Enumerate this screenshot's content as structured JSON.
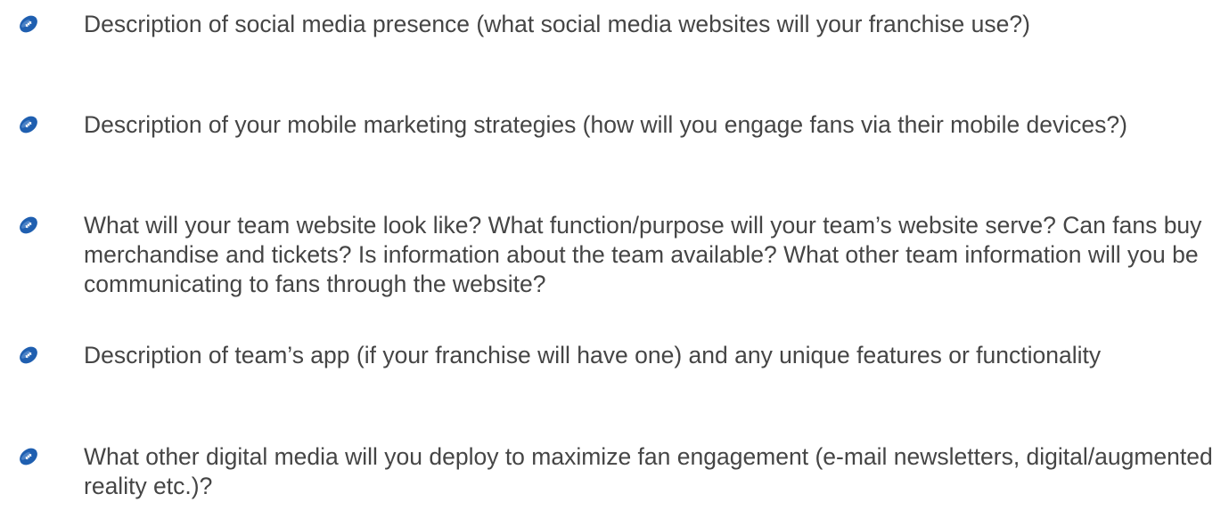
{
  "bullet_icon": "football-icon",
  "colors": {
    "bullet_fill": "#1f5fb0",
    "text": "#454545"
  },
  "items": [
    {
      "text": "Description of social media presence (what social media websites will your franchise use?)"
    },
    {
      "text": "Description of your mobile marketing strategies (how will you engage fans via their mobile devices?)"
    },
    {
      "text": "What will your team website look like?  What function/purpose will your team’s website serve?  Can fans buy merchandise and tickets?  Is information about the team available?  What other team information will you be communicating to fans through the website?"
    },
    {
      "text": "Description of team’s app (if your franchise will have one) and any unique features or functionality"
    },
    {
      "text": "What other digital media will you deploy to maximize fan engagement (e-mail newsletters, digital/augmented reality etc.)?"
    }
  ]
}
